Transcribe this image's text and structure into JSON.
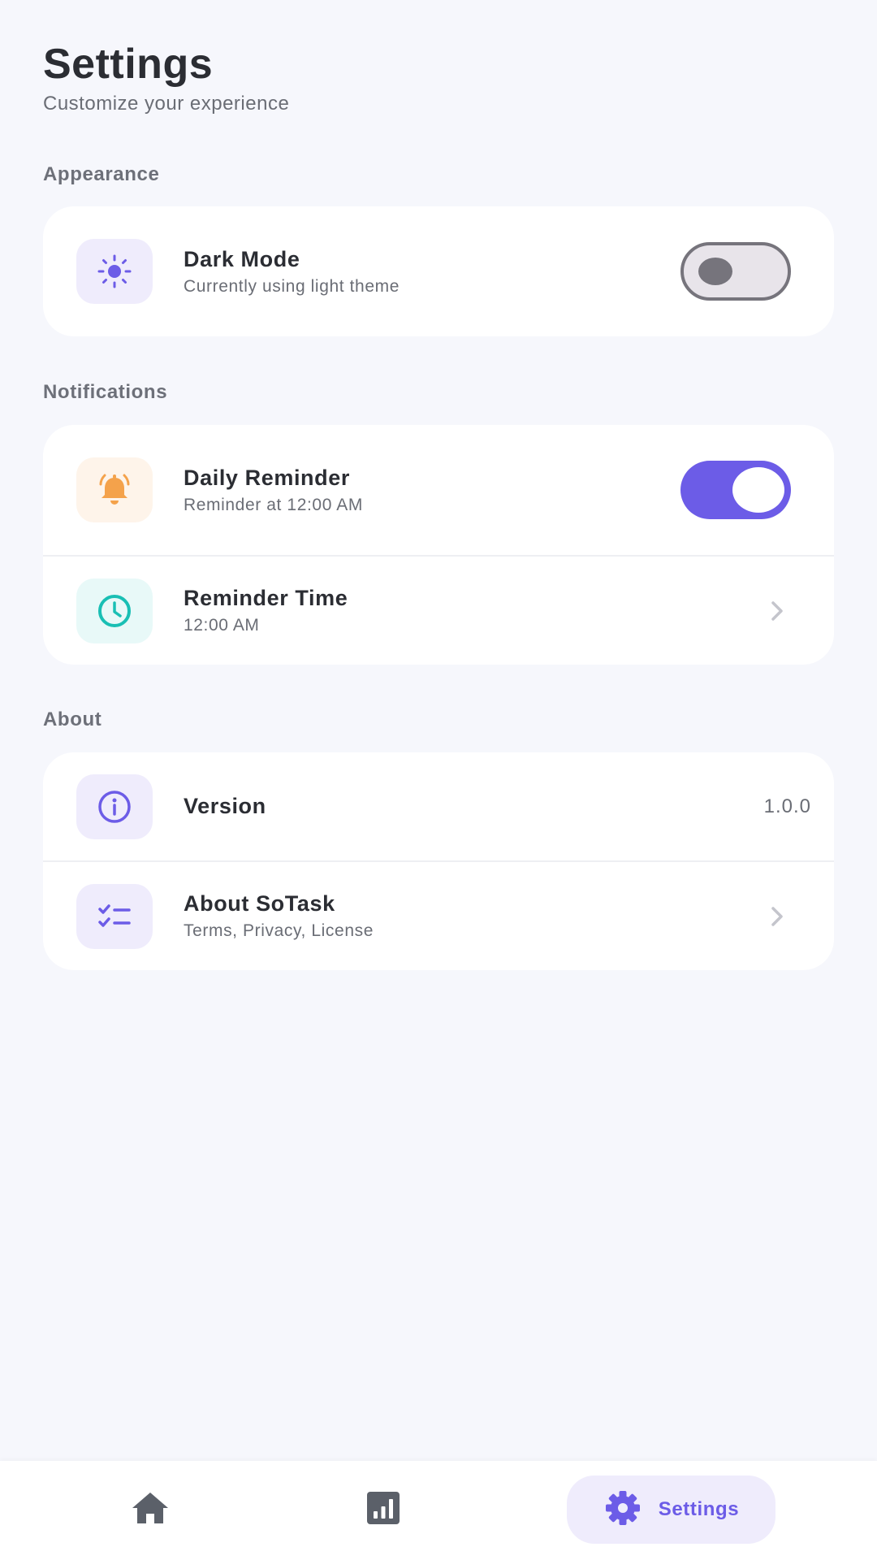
{
  "header": {
    "title": "Settings",
    "subtitle": "Customize your experience"
  },
  "sections": {
    "appearance": {
      "label": "Appearance",
      "dark_mode": {
        "title": "Dark Mode",
        "subtitle": "Currently using light theme",
        "enabled": false,
        "icon": "sun-icon"
      }
    },
    "notifications": {
      "label": "Notifications",
      "daily_reminder": {
        "title": "Daily Reminder",
        "subtitle": "Reminder at 12:00 AM",
        "enabled": true,
        "icon": "bell-icon"
      },
      "reminder_time": {
        "title": "Reminder Time",
        "subtitle": "12:00 AM",
        "icon": "clock-icon"
      }
    },
    "about": {
      "label": "About",
      "version": {
        "title": "Version",
        "value": "1.0.0",
        "icon": "info-icon"
      },
      "about_app": {
        "title": "About SoTask",
        "subtitle": "Terms, Privacy, License",
        "icon": "checklist-icon"
      }
    }
  },
  "bottom_nav": {
    "home_icon": "home-icon",
    "stats_icon": "chart-icon",
    "settings_label": "Settings",
    "settings_icon": "gear-icon",
    "active": "settings"
  },
  "colors": {
    "accent": "#6c5ce7",
    "background": "#f6f7fc",
    "card": "#ffffff",
    "bell": "#f4a24b",
    "clock": "#19bfb4"
  }
}
